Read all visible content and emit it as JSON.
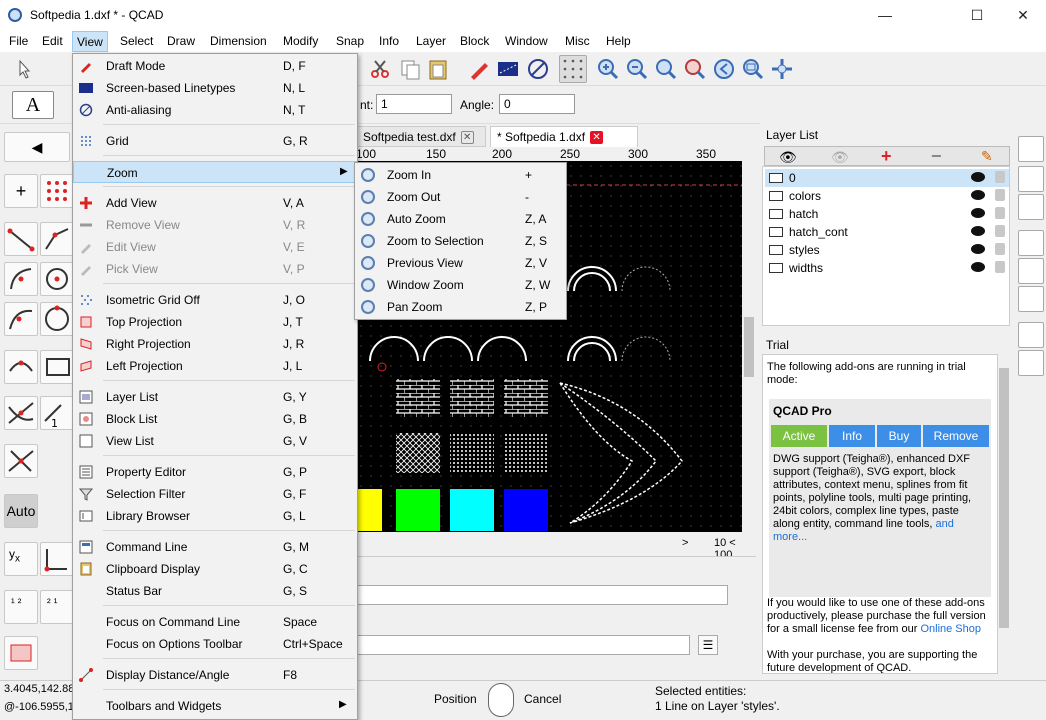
{
  "window": {
    "title": "Softpedia 1.dxf * - QCAD",
    "min": "—",
    "max": "☐",
    "close": "✕"
  },
  "menubar": [
    "File",
    "Edit",
    "View",
    "Select",
    "Draw",
    "Dimension",
    "Modify",
    "Snap",
    "Info",
    "Layer",
    "Block",
    "Window",
    "Misc",
    "Help"
  ],
  "options_toolbar": {
    "text_tool_label": "A",
    "angle_label": "Angle:",
    "angle_value": "0",
    "field1_label": "nt:",
    "field1_value": "1"
  },
  "tabs": [
    {
      "label": "Softpedia test.dxf"
    },
    {
      "label": "* Softpedia 1.dxf"
    }
  ],
  "ruler": [
    "100",
    "150",
    "200",
    "250",
    "300",
    "350"
  ],
  "left_auto": "Auto",
  "canvas_status": {
    "grid": "10 < 100",
    "arrow": ">"
  },
  "view_menu": [
    {
      "label": "Draft Mode",
      "shortcut": "D, F",
      "enabled": true,
      "icon": "draft-icon"
    },
    {
      "label": "Screen-based Linetypes",
      "shortcut": "N, L",
      "enabled": true,
      "icon": "linetype-icon"
    },
    {
      "label": "Anti-aliasing",
      "shortcut": "N, T",
      "enabled": true,
      "icon": "antialias-icon"
    },
    {
      "label": "Grid",
      "shortcut": "G, R",
      "enabled": true,
      "icon": "grid-icon"
    },
    {
      "label": "Zoom",
      "shortcut": "",
      "enabled": true,
      "icon": "zoom-icon",
      "submenu": true
    },
    {
      "label": "Add View",
      "shortcut": "V, A",
      "enabled": true,
      "icon": "plus-icon"
    },
    {
      "label": "Remove View",
      "shortcut": "V, R",
      "enabled": false,
      "icon": "minus-icon"
    },
    {
      "label": "Edit View",
      "shortcut": "V, E",
      "enabled": false,
      "icon": "pencil-icon"
    },
    {
      "label": "Pick View",
      "shortcut": "V, P",
      "enabled": false,
      "icon": "pick-icon"
    },
    {
      "label": "Isometric Grid Off",
      "shortcut": "J, O",
      "enabled": true,
      "icon": "iso-grid-icon"
    },
    {
      "label": "Top Projection",
      "shortcut": "J, T",
      "enabled": true,
      "icon": "top-proj-icon"
    },
    {
      "label": "Right Projection",
      "shortcut": "J, R",
      "enabled": true,
      "icon": "right-proj-icon"
    },
    {
      "label": "Left Projection",
      "shortcut": "J, L",
      "enabled": true,
      "icon": "left-proj-icon"
    },
    {
      "label": "Layer List",
      "shortcut": "G, Y",
      "enabled": true,
      "icon": "layer-list-icon"
    },
    {
      "label": "Block List",
      "shortcut": "G, B",
      "enabled": true,
      "icon": "block-list-icon"
    },
    {
      "label": "View List",
      "shortcut": "G, V",
      "enabled": true,
      "icon": "view-list-icon"
    },
    {
      "label": "Property Editor",
      "shortcut": "G, P",
      "enabled": true,
      "icon": "property-icon"
    },
    {
      "label": "Selection Filter",
      "shortcut": "G, F",
      "enabled": true,
      "icon": "filter-icon"
    },
    {
      "label": "Library Browser",
      "shortcut": "G, L",
      "enabled": true,
      "icon": "library-icon"
    },
    {
      "label": "Command Line",
      "shortcut": "G, M",
      "enabled": true,
      "icon": "cmdline-icon"
    },
    {
      "label": "Clipboard Display",
      "shortcut": "G, C",
      "enabled": true,
      "icon": "clipboard-icon"
    },
    {
      "label": "Status Bar",
      "shortcut": "G, S",
      "enabled": true,
      "icon": ""
    },
    {
      "label": "Focus on Command Line",
      "shortcut": "Space",
      "enabled": true,
      "icon": ""
    },
    {
      "label": "Focus on Options Toolbar",
      "shortcut": "Ctrl+Space",
      "enabled": true,
      "icon": ""
    },
    {
      "label": "Display Distance/Angle",
      "shortcut": "F8",
      "enabled": true,
      "icon": "distance-icon"
    },
    {
      "label": "Toolbars and Widgets",
      "shortcut": "",
      "enabled": true,
      "icon": "",
      "submenu": true
    }
  ],
  "zoom_submenu": [
    {
      "label": "Zoom In",
      "shortcut": "+"
    },
    {
      "label": "Zoom Out",
      "shortcut": "-"
    },
    {
      "label": "Auto Zoom",
      "shortcut": "Z, A"
    },
    {
      "label": "Zoom to Selection",
      "shortcut": "Z, S"
    },
    {
      "label": "Previous View",
      "shortcut": "Z, V"
    },
    {
      "label": "Window Zoom",
      "shortcut": "Z, W"
    },
    {
      "label": "Pan Zoom",
      "shortcut": "Z, P"
    }
  ],
  "layer_panel": {
    "title": "Layer List",
    "layers": [
      "0",
      "colors",
      "hatch",
      "hatch_cont",
      "styles",
      "widths"
    ]
  },
  "trial": {
    "title": "Trial",
    "intro": "The following add-ons are running in trial mode:",
    "product": "QCAD Pro",
    "buttons": [
      "Active",
      "Info",
      "Buy",
      "Remove"
    ],
    "description": "DWG support (Teigha®), enhanced DXF support (Teigha®), SVG export, block attributes, context menu, splines from fit points, polyline tools, multi page printing, 24bit colors, complex line types, paste along entity, command line tools,",
    "and_more": "and more...",
    "purchase": "If you would like to use one of these add-ons productively, please purchase the full version for a small license fee from our",
    "shop": "Online Shop",
    "support": "With your purchase, you are supporting the future development of QCAD."
  },
  "statusbar": {
    "coord1": "3.4045,142.88",
    "coord2": "@-106.5955,1",
    "position": "Position",
    "cancel": "Cancel",
    "selected_label": "Selected entities:",
    "selected_value": "1 Line on Layer 'styles'."
  },
  "colors": {
    "accent": "#cce4f7",
    "trial_blue": "#3d8ee6",
    "trial_green": "#7bc142",
    "link": "#1a6fd6"
  }
}
